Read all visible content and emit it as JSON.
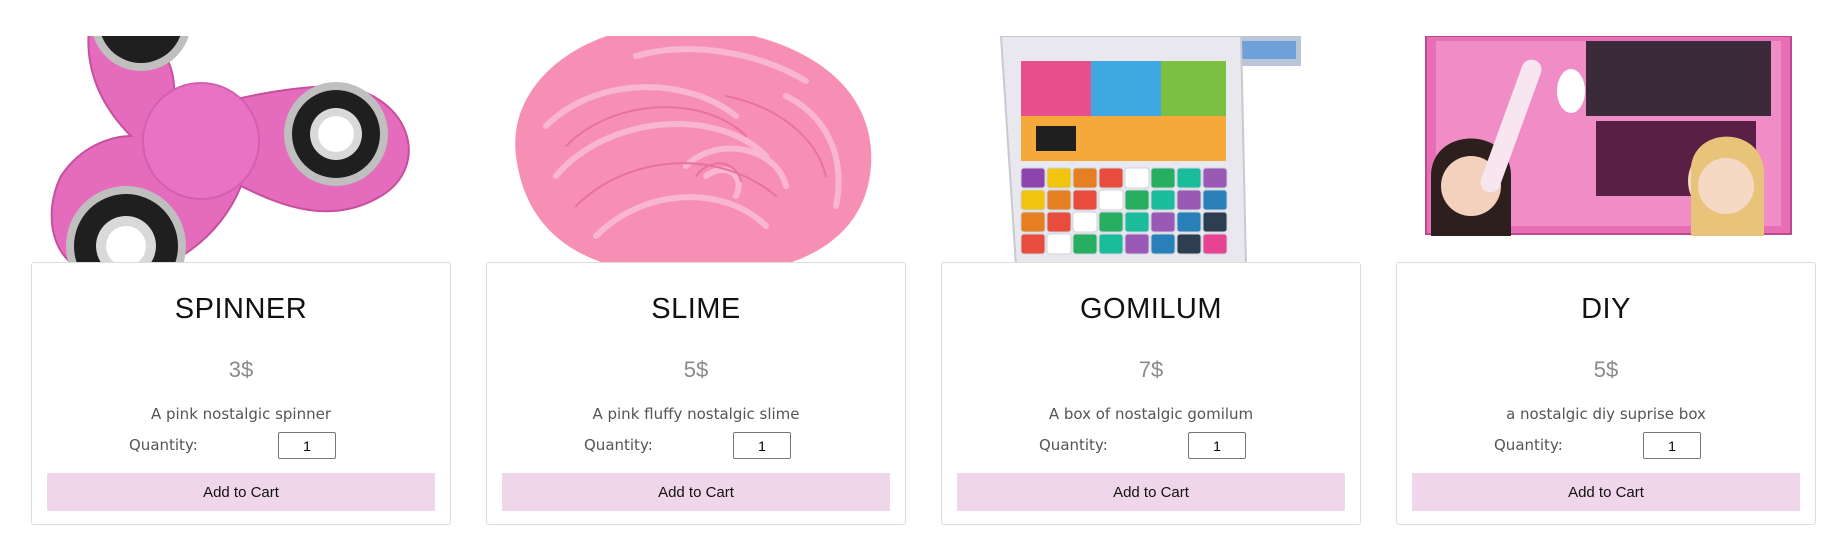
{
  "products": [
    {
      "title": "SPINNER",
      "price": "3$",
      "description": "A pink nostalgic spinner",
      "quantity_label": "Quantity:",
      "quantity_value": "1",
      "add_to_cart_label": "Add to Cart",
      "image": "pink-fidget-spinner"
    },
    {
      "title": "SLIME",
      "price": "5$",
      "description": "A pink fluffy nostalgic slime",
      "quantity_label": "Quantity:",
      "quantity_value": "1",
      "add_to_cart_label": "Add to Cart",
      "image": "pink-fluffy-slime"
    },
    {
      "title": "GOMILUM",
      "price": "7$",
      "description": "A box of nostalgic gomilum",
      "quantity_label": "Quantity:",
      "quantity_value": "1",
      "add_to_cart_label": "Add to Cart",
      "image": "loom-band-box"
    },
    {
      "title": "DIY",
      "price": "5$",
      "description": "a nostalgic diy suprise box",
      "quantity_label": "Quantity:",
      "quantity_value": "1",
      "add_to_cart_label": "Add to Cart",
      "image": "bracelet-braiding-kit"
    }
  ],
  "colors": {
    "button_bg": "#efd6ea",
    "card_border": "#dcdcdc",
    "price_text": "#8a8a8a"
  }
}
